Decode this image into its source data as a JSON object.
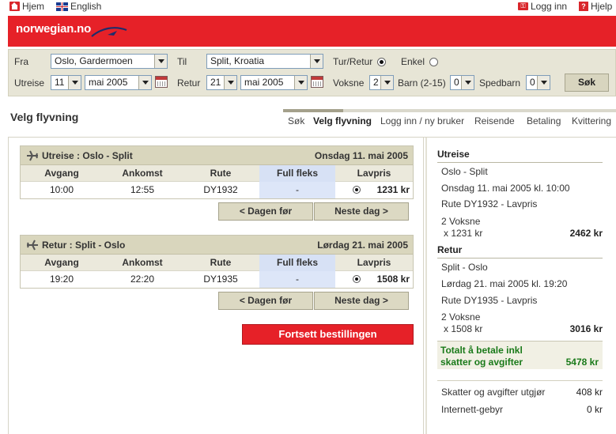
{
  "toplinks": {
    "home": "Hjem",
    "english": "English",
    "login": "Logg inn",
    "help": "Hjelp"
  },
  "brand": {
    "logo": "norwegian.no",
    "color": "#e62128"
  },
  "search": {
    "from_label": "Fra",
    "from_value": "Oslo, Gardermoen",
    "to_label": "Til",
    "to_value": "Split, Kroatia",
    "roundtrip_label": "Tur/Retur",
    "oneway_label": "Enkel",
    "trip_type_selected": "Tur/Retur",
    "out_label": "Utreise",
    "out_day": "11",
    "out_month": "mai 2005",
    "ret_label": "Retur",
    "ret_day": "21",
    "ret_month": "mai 2005",
    "adults_label": "Voksne",
    "adults_value": "2",
    "children_label": "Barn (2-15)",
    "children_value": "0",
    "infants_label": "Spedbarn",
    "infants_value": "0",
    "search_button": "Søk"
  },
  "page_title": "Velg flyvning",
  "steps": [
    "Søk",
    "Velg flyvning",
    "Logg inn / ny bruker",
    "Reisende",
    "Betaling",
    "Kvittering"
  ],
  "columns": {
    "departure": "Avgang",
    "arrival": "Ankomst",
    "route": "Rute",
    "flex": "Full fleks",
    "low": "Lavpris"
  },
  "outbound": {
    "title": "Utreise :  Oslo - Split",
    "date": "Onsdag 11. mai 2005",
    "departure": "10:00",
    "arrival": "12:55",
    "route": "DY1932",
    "flex": "-",
    "low_price": "1231 kr",
    "prev_day": "< Dagen før",
    "next_day": "Neste dag >"
  },
  "inbound": {
    "title": "Retur :  Split - Oslo",
    "date": "Lørdag 21. mai 2005",
    "departure": "19:20",
    "arrival": "22:20",
    "route": "DY1935",
    "flex": "-",
    "low_price": "1508 kr",
    "prev_day": "< Dagen før",
    "next_day": "Neste dag >"
  },
  "continue_button": "Fortsett bestillingen",
  "summary": {
    "out_heading": "Utreise",
    "out_route": "Oslo - Split",
    "out_when": "Onsdag 11. mai 2005 kl. 10:00",
    "out_flight": "Rute DY1932 - Lavpris",
    "out_pax": "2 Voksne",
    "out_unit": "x 1231 kr",
    "out_total": "2462 kr",
    "ret_heading": "Retur",
    "ret_route": "Split - Oslo",
    "ret_when": "Lørdag 21. mai 2005 kl. 19:20",
    "ret_flight": "Rute DY1935 - Lavpris",
    "ret_pax": "2 Voksne",
    "ret_unit": "x 1508 kr",
    "ret_total": "3016 kr",
    "total_label_1": "Totalt å betale inkl",
    "total_label_2": "skatter og avgifter",
    "total_value": "5478 kr",
    "tax_label": "Skatter og avgifter utgjør",
    "tax_value": "408 kr",
    "fee_label": "Internett-gebyr",
    "fee_value": "0 kr"
  }
}
